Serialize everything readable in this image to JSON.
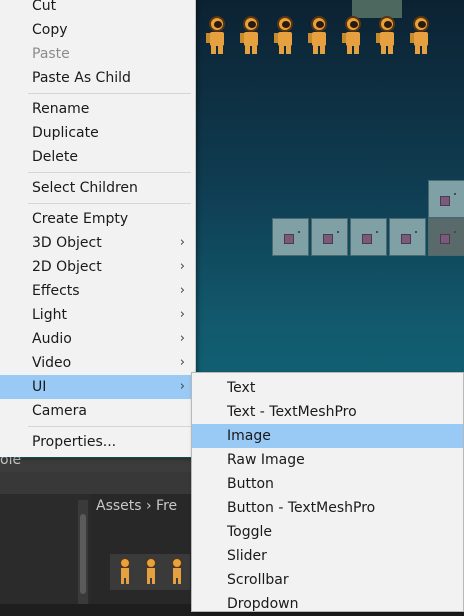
{
  "context_menu": {
    "items": [
      {
        "label": "Cut",
        "enabled": true
      },
      {
        "label": "Copy",
        "enabled": true
      },
      {
        "label": "Paste",
        "enabled": false
      },
      {
        "label": "Paste As Child",
        "enabled": true
      },
      {
        "label": "Rename",
        "enabled": true
      },
      {
        "label": "Duplicate",
        "enabled": true
      },
      {
        "label": "Delete",
        "enabled": true
      },
      {
        "label": "Select Children",
        "enabled": true
      },
      {
        "label": "Create Empty",
        "enabled": true
      },
      {
        "label": "3D Object",
        "submenu": true
      },
      {
        "label": "2D Object",
        "submenu": true
      },
      {
        "label": "Effects",
        "submenu": true
      },
      {
        "label": "Light",
        "submenu": true
      },
      {
        "label": "Audio",
        "submenu": true
      },
      {
        "label": "Video",
        "submenu": true
      },
      {
        "label": "UI",
        "submenu": true,
        "highlighted": true
      },
      {
        "label": "Camera",
        "enabled": true
      },
      {
        "label": "Properties...",
        "enabled": true
      }
    ],
    "arrow_glyph": "›"
  },
  "ui_submenu": {
    "items": [
      {
        "label": "Text"
      },
      {
        "label": "Text - TextMeshPro"
      },
      {
        "label": "Image",
        "highlighted": true
      },
      {
        "label": "Raw Image"
      },
      {
        "label": "Button"
      },
      {
        "label": "Button - TextMeshPro"
      },
      {
        "label": "Toggle"
      },
      {
        "label": "Slider"
      },
      {
        "label": "Scrollbar"
      },
      {
        "label": "Dropdown"
      }
    ]
  },
  "project_panel": {
    "tab_text_fragment": "ole",
    "breadcrumb": "Assets › Fre"
  },
  "colors": {
    "menu_background": "#f2f2f2",
    "highlight": "#99c9f5",
    "disabled_text": "#8c8c8c"
  }
}
